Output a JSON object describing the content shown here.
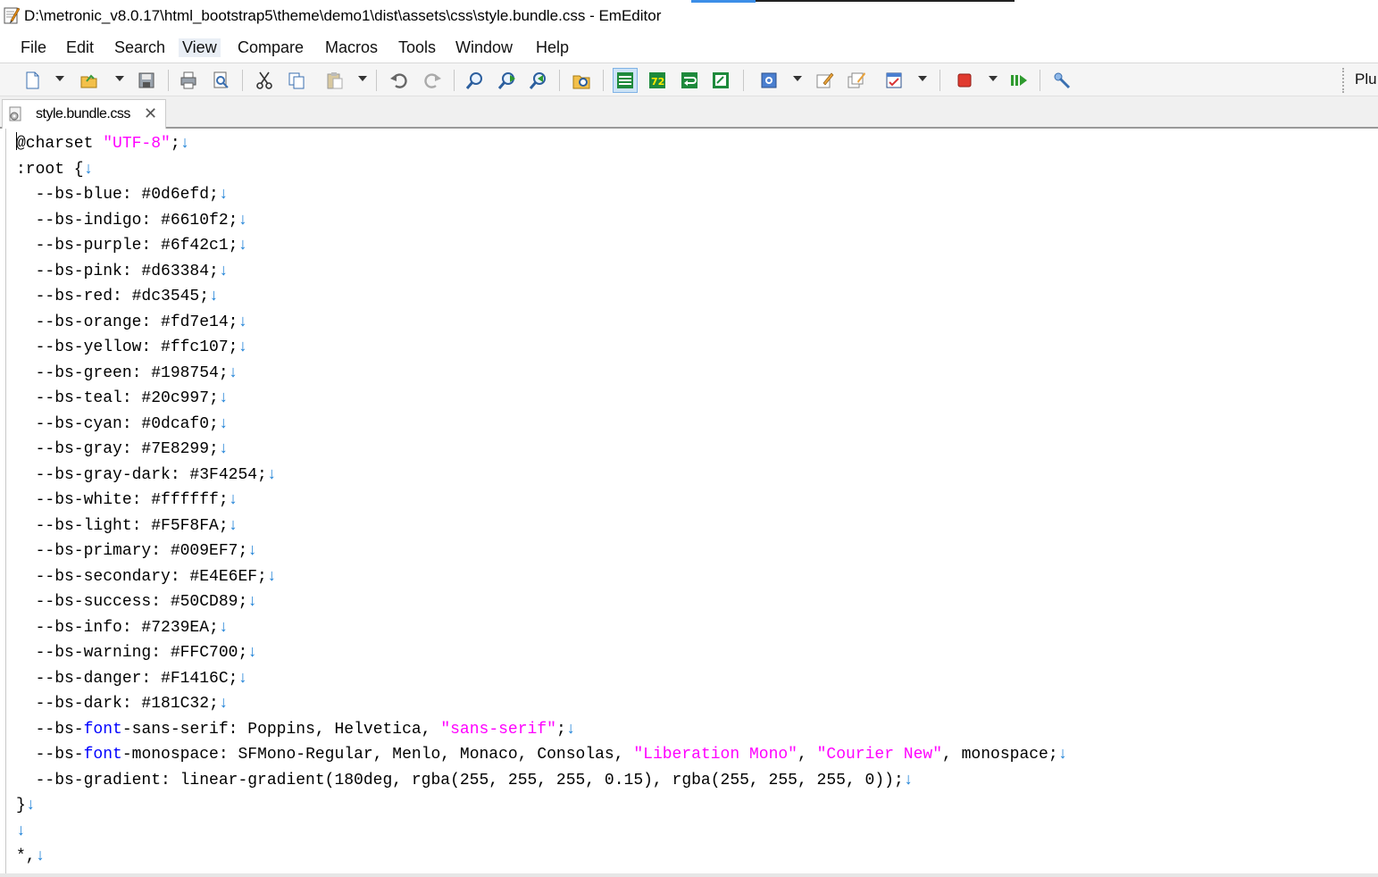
{
  "window": {
    "title": "D:\\metronic_v8.0.17\\html_bootstrap5\\theme\\demo1\\dist\\assets\\css\\style.bundle.css - EmEditor"
  },
  "menu": [
    "File",
    "Edit",
    "Search",
    "View",
    "Compare",
    "Macros",
    "Tools",
    "Window",
    "Help"
  ],
  "active_menu": "View",
  "toolbar": {
    "overflow_label": "Plu",
    "buttons": [
      "new-file",
      "open-file",
      "save",
      "print",
      "print-preview",
      "cut",
      "copy",
      "paste",
      "undo",
      "redo",
      "find",
      "find-next",
      "find-previous",
      "find-in-files",
      "wrap-none",
      "wrap-window",
      "wrap-page",
      "wrap-chars",
      "word-wrap",
      "pin",
      "cascade",
      "checklist",
      "stop-macro",
      "run-macro",
      "plugin"
    ]
  },
  "tab": {
    "label": "style.bundle.css",
    "close_glyph": "✕"
  },
  "colors": {
    "string": "#ff00ff",
    "keyword": "#0000ff",
    "newline_mark": "#1a7fd6",
    "text": "#000000"
  },
  "newline_glyph": "↓",
  "code_lines": [
    [
      {
        "t": "@charset ",
        "c": "at"
      },
      {
        "t": "\"UTF-8\"",
        "c": "str"
      },
      {
        "t": ";",
        "c": "default"
      }
    ],
    [
      {
        "t": ":root {",
        "c": "default"
      }
    ],
    [
      {
        "t": "  --bs-blue: #0d6efd;",
        "c": "default"
      }
    ],
    [
      {
        "t": "  --bs-indigo: #6610f2;",
        "c": "default"
      }
    ],
    [
      {
        "t": "  --bs-purple: #6f42c1;",
        "c": "default"
      }
    ],
    [
      {
        "t": "  --bs-pink: #d63384;",
        "c": "default"
      }
    ],
    [
      {
        "t": "  --bs-red: #dc3545;",
        "c": "default"
      }
    ],
    [
      {
        "t": "  --bs-orange: #fd7e14;",
        "c": "default"
      }
    ],
    [
      {
        "t": "  --bs-yellow: #ffc107;",
        "c": "default"
      }
    ],
    [
      {
        "t": "  --bs-green: #198754;",
        "c": "default"
      }
    ],
    [
      {
        "t": "  --bs-teal: #20c997;",
        "c": "default"
      }
    ],
    [
      {
        "t": "  --bs-cyan: #0dcaf0;",
        "c": "default"
      }
    ],
    [
      {
        "t": "  --bs-gray: #7E8299;",
        "c": "default"
      }
    ],
    [
      {
        "t": "  --bs-gray-dark: #3F4254;",
        "c": "default"
      }
    ],
    [
      {
        "t": "  --bs-white: #ffffff;",
        "c": "default"
      }
    ],
    [
      {
        "t": "  --bs-light: #F5F8FA;",
        "c": "default"
      }
    ],
    [
      {
        "t": "  --bs-primary: #009EF7;",
        "c": "default"
      }
    ],
    [
      {
        "t": "  --bs-secondary: #E4E6EF;",
        "c": "default"
      }
    ],
    [
      {
        "t": "  --bs-success: #50CD89;",
        "c": "default"
      }
    ],
    [
      {
        "t": "  --bs-info: #7239EA;",
        "c": "default"
      }
    ],
    [
      {
        "t": "  --bs-warning: #FFC700;",
        "c": "default"
      }
    ],
    [
      {
        "t": "  --bs-danger: #F1416C;",
        "c": "default"
      }
    ],
    [
      {
        "t": "  --bs-dark: #181C32;",
        "c": "default"
      }
    ],
    [
      {
        "t": "  --bs-",
        "c": "default"
      },
      {
        "t": "font",
        "c": "kw"
      },
      {
        "t": "-sans-serif: Poppins, Helvetica, ",
        "c": "default"
      },
      {
        "t": "\"sans-serif\"",
        "c": "str"
      },
      {
        "t": ";",
        "c": "default"
      }
    ],
    [
      {
        "t": "  --bs-",
        "c": "default"
      },
      {
        "t": "font",
        "c": "kw"
      },
      {
        "t": "-monospace: SFMono-Regular, Menlo, Monaco, Consolas, ",
        "c": "default"
      },
      {
        "t": "\"Liberation Mono\"",
        "c": "str"
      },
      {
        "t": ", ",
        "c": "default"
      },
      {
        "t": "\"Courier New\"",
        "c": "str"
      },
      {
        "t": ", monospace;",
        "c": "default"
      }
    ],
    [
      {
        "t": "  --bs-gradient: linear-gradient(180deg, rgba(255, 255, 255, 0.15), rgba(255, 255, 255, 0));",
        "c": "default"
      }
    ],
    [
      {
        "t": "}",
        "c": "default"
      }
    ],
    [],
    [
      {
        "t": "*,",
        "c": "default"
      }
    ]
  ]
}
